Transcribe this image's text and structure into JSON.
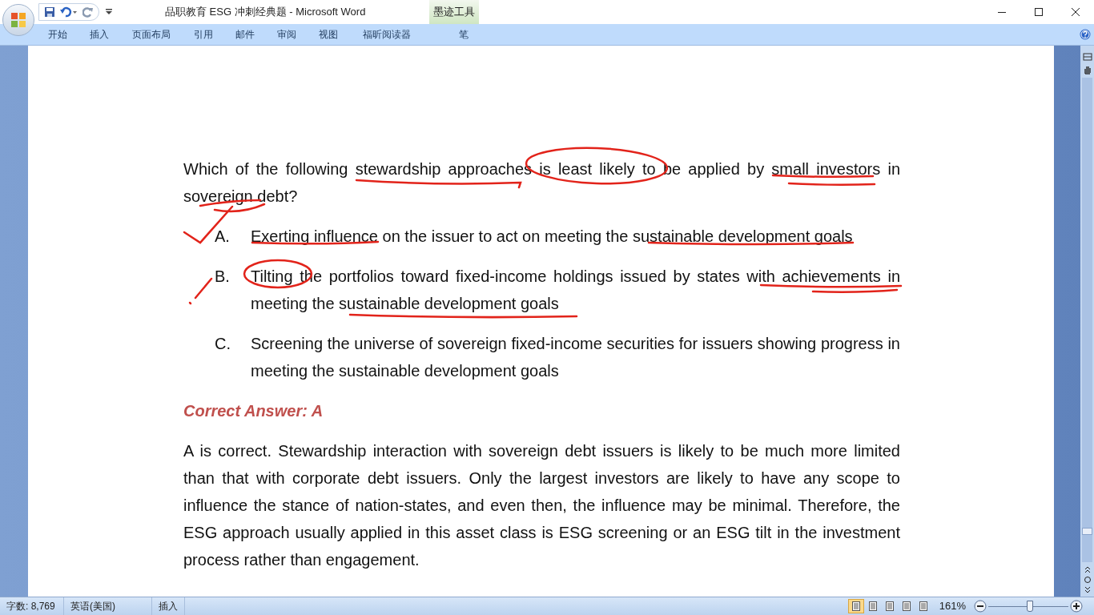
{
  "window": {
    "title": "品职教育 ESG 冲刺经典题 - Microsoft Word",
    "contextual_tab": "墨迹工具"
  },
  "ribbon_tabs": [
    {
      "label": "开始"
    },
    {
      "label": "插入"
    },
    {
      "label": "页面布局"
    },
    {
      "label": "引用"
    },
    {
      "label": "邮件"
    },
    {
      "label": "审阅"
    },
    {
      "label": "视图"
    },
    {
      "label": "福昕阅读器"
    },
    {
      "label": "笔"
    }
  ],
  "document": {
    "question": "Which of the following stewardship approaches is least likely to be applied by small investors in sovereign debt?",
    "options": [
      {
        "letter": "A.",
        "text": "Exerting influence on the issuer to act on meeting the sustainable development goals"
      },
      {
        "letter": "B.",
        "text": "Tilting the portfolios toward fixed-income holdings issued by states with achievements in meeting the sustainable development goals"
      },
      {
        "letter": "C.",
        "text": "Screening the universe of sovereign fixed-income securities for issuers showing progress in meeting the sustainable development goals"
      }
    ],
    "answer_heading": "Correct Answer: A",
    "explanation": "A is correct. Stewardship interaction with sovereign debt issuers is likely to be much more limited than that with corporate debt issuers. Only the largest investors are likely to have any scope to influence the stance of nation-states, and even then, the influence may be minimal. Therefore, the ESG approach usually applied in this asset class is ESG screening or an ESG tilt in the investment process rather than engagement."
  },
  "status_bar": {
    "word_count": "字数: 8,769",
    "language": "英语(美国)",
    "mode": "插入",
    "views": [
      {
        "selected": true
      },
      {
        "selected": false
      },
      {
        "selected": false
      },
      {
        "selected": false
      },
      {
        "selected": false
      }
    ],
    "zoom": "161%",
    "zoom_slider": {
      "level": 0.52
    }
  }
}
